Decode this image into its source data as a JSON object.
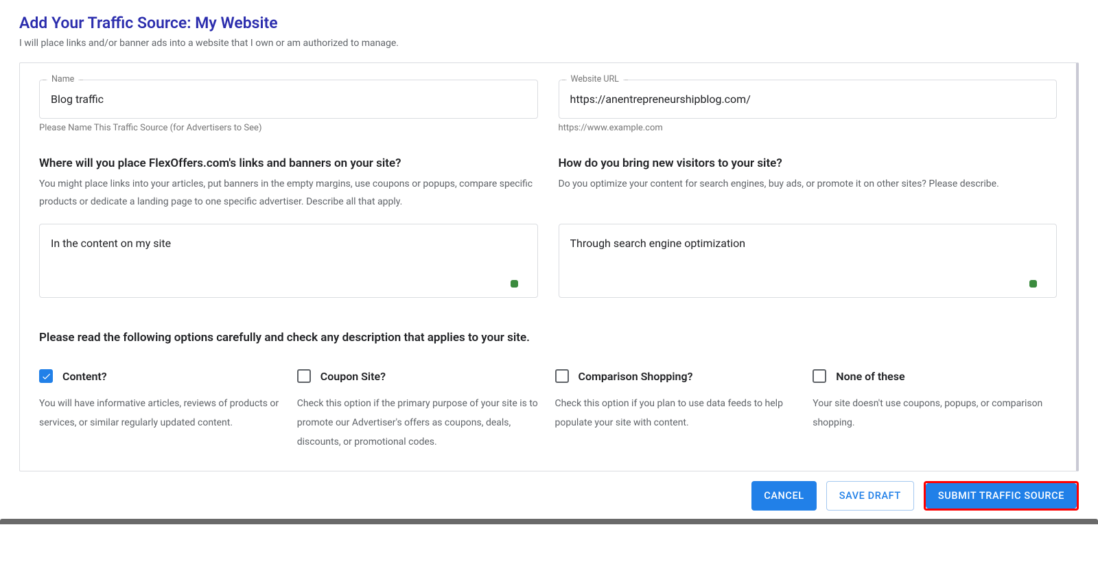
{
  "header": {
    "title": "Add Your Traffic Source: My Website",
    "subtitle": "I will place links and/or banner ads into a website that I own or am authorized to manage."
  },
  "form": {
    "name": {
      "label": "Name",
      "value": "Blog traffic",
      "helper": "Please Name This Traffic Source (for Advertisers to See)"
    },
    "url": {
      "label": "Website URL",
      "value": "https://anentrepreneurshipblog.com/",
      "helper": "https://www.example.com"
    },
    "placement": {
      "heading": "Where will you place FlexOffers.com's links and banners on your site?",
      "desc": "You might place links into your articles, put banners in the empty margins, use coupons or popups, compare specific products or dedicate a landing page to one specific advertiser. Describe all that apply.",
      "value": "In the content on my site"
    },
    "visitors": {
      "heading": "How do you bring new visitors to your site?",
      "desc": "Do you optimize your content for search engines, buy ads, or promote it on other sites? Please describe.",
      "value": "Through search engine optimization"
    },
    "options_heading": "Please read the following options carefully and check any description that applies to your site.",
    "options": {
      "content": {
        "label": "Content?",
        "desc": "You will have informative articles, reviews of products or services, or similar regularly updated content.",
        "checked": true
      },
      "coupon": {
        "label": "Coupon Site?",
        "desc": "Check this option if the primary purpose of your site is to promote our Advertiser's offers as coupons, deals, discounts, or promotional codes.",
        "checked": false
      },
      "comparison": {
        "label": "Comparison Shopping?",
        "desc": "Check this option if you plan to use data feeds to help populate your site with content.",
        "checked": false
      },
      "none": {
        "label": "None of these",
        "desc": "Your site doesn't use coupons, popups, or comparison shopping.",
        "checked": false
      }
    }
  },
  "buttons": {
    "cancel": "CANCEL",
    "draft": "SAVE DRAFT",
    "submit": "SUBMIT TRAFFIC SOURCE"
  }
}
